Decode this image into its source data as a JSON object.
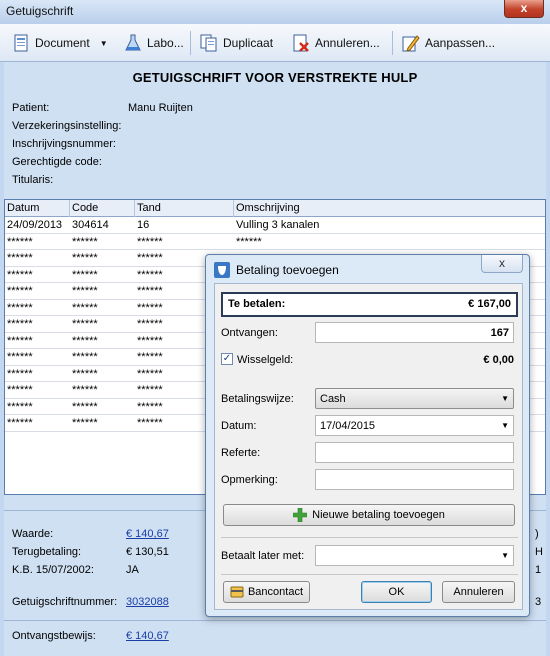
{
  "window": {
    "title": "Getuigschrift",
    "close_glyph": "x"
  },
  "toolbar": {
    "document": "Document",
    "labo": "Labo...",
    "duplicaat": "Duplicaat",
    "annuleren": "Annuleren...",
    "aanpassen": "Aanpassen...",
    "dropdown_glyph": "▼"
  },
  "header": {
    "title": "GETUIGSCHRIFT VOOR VERSTREKTE HULP",
    "fields": [
      {
        "label": "Patient:",
        "value": "Manu Ruijten"
      },
      {
        "label": "Verzekeringsinstelling:",
        "value": ""
      },
      {
        "label": "Inschrijvingsnummer:",
        "value": ""
      },
      {
        "label": "Gerechtigde code:",
        "value": ""
      },
      {
        "label": "Titularis:",
        "value": ""
      }
    ]
  },
  "grid": {
    "columns": [
      "Datum",
      "Code",
      "Tand",
      "Omschrijving"
    ],
    "rows": [
      [
        "24/09/2013",
        "304614",
        "16",
        "Vulling 3 kanalen"
      ],
      [
        "******",
        "******",
        "******",
        "******"
      ],
      [
        "******",
        "******",
        "******",
        ""
      ],
      [
        "******",
        "******",
        "******",
        ""
      ],
      [
        "******",
        "******",
        "******",
        ""
      ],
      [
        "******",
        "******",
        "******",
        ""
      ],
      [
        "******",
        "******",
        "******",
        ""
      ],
      [
        "******",
        "******",
        "******",
        ""
      ],
      [
        "******",
        "******",
        "******",
        ""
      ],
      [
        "******",
        "******",
        "******",
        ""
      ],
      [
        "******",
        "******",
        "******",
        ""
      ],
      [
        "******",
        "******",
        "******",
        ""
      ],
      [
        "******",
        "******",
        "******",
        ""
      ]
    ]
  },
  "summary": {
    "waarde_label": "Waarde:",
    "waarde_value": "€ 140,67",
    "terug_label": "Terugbetaling:",
    "terug_value": "€ 130,51",
    "kb_label": "K.B. 15/07/2002:",
    "kb_value": "JA",
    "nummer_label": "Getuigschriftnummer:",
    "nummer_value": "3032088",
    "ontvangst_label": "Ontvangstbewijs:",
    "ontvangst_value": "€ 140,67",
    "edge_chars": [
      ")",
      "H",
      "1",
      "3"
    ]
  },
  "dialog": {
    "title": "Betaling toevoegen",
    "close_glyph": "x",
    "te_betalen_label": "Te betalen:",
    "te_betalen_value": "€ 167,00",
    "ontvangen_label": "Ontvangen:",
    "ontvangen_value": "167",
    "wisselgeld_label": "Wisselgeld:",
    "wisselgeld_checked": "✓",
    "wisselgeld_value": "€ 0,00",
    "betalingswijze_label": "Betalingswijze:",
    "betalingswijze_value": "Cash",
    "datum_label": "Datum:",
    "datum_value": "17/04/2015",
    "referte_label": "Referte:",
    "referte_value": "",
    "opmerking_label": "Opmerking:",
    "opmerking_value": "",
    "nieuwe_betaling": "Nieuwe betaling toevoegen",
    "later_label": "Betaalt later met:",
    "later_value": "",
    "bancontact": "Bancontact",
    "ok": "OK",
    "annuleren": "Annuleren",
    "arrow_glyph": "▼"
  },
  "colors": {
    "accent": "#1a3ea8",
    "window_bg": "#cfe0f3",
    "close_red": "#c2422a",
    "plus_green": "#3fa33a"
  }
}
